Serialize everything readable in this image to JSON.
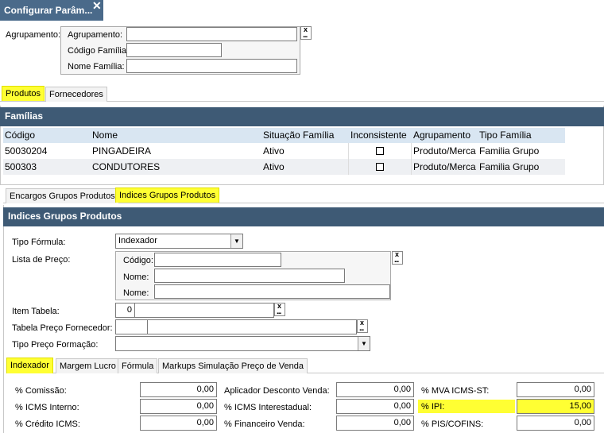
{
  "window": {
    "title": "Configurar Parâm..."
  },
  "agrupamento": {
    "outer_label": "Agrupamento:",
    "fields": [
      {
        "label": "Agrupamento:",
        "value": ""
      },
      {
        "label": "Código Família:",
        "value": ""
      },
      {
        "label": "Nome Família:",
        "value": ""
      }
    ]
  },
  "top_tabs": [
    "Produtos",
    "Fornecedores"
  ],
  "familias": {
    "title": "Famílias",
    "columns": [
      "Código",
      "Nome",
      "Situação Família",
      "Inconsistente",
      "Agrupamento",
      "Tipo Família"
    ],
    "rows": [
      {
        "codigo": "50030204",
        "nome": "PINGADEIRA",
        "situacao": "Ativo",
        "inconsistente": false,
        "agrupamento": "Produto/Merca",
        "tipo": "Familia Grupo"
      },
      {
        "codigo": "500303",
        "nome": "CONDUTORES",
        "situacao": "Ativo",
        "inconsistente": false,
        "agrupamento": "Produto/Merca",
        "tipo": "Familia Grupo"
      }
    ]
  },
  "sub_tabs": [
    "Encargos Grupos Produtos",
    "Indices Grupos Produtos"
  ],
  "indices": {
    "title": "Indices Grupos Produtos",
    "tipo_formula": {
      "label": "Tipo Fórmula:",
      "value": "Indexador"
    },
    "lista_preco": {
      "label": "Lista de Preço:",
      "codigo_label": "Código:",
      "codigo_value": "",
      "nome1_label": "Nome:",
      "nome1_value": "",
      "nome2_label": "Nome:",
      "nome2_value": ""
    },
    "item_tabela": {
      "label": "Item Tabela:",
      "value": "0",
      "value2": ""
    },
    "tabela_fornecedor": {
      "label": "Tabela Preço Fornecedor:",
      "value": "",
      "value2": ""
    },
    "tipo_preco": {
      "label": "Tipo Preço Formação:",
      "value": ""
    }
  },
  "bottom_tabs": [
    "Indexador",
    "Margem Lucro",
    "Fórmula",
    "Markups Simulação Preço de Venda"
  ],
  "indexador": {
    "rows": [
      [
        {
          "label": "% Comissão:",
          "value": "0,00"
        },
        {
          "label": "Aplicador Desconto Venda:",
          "value": "0,00"
        },
        {
          "label": "% MVA ICMS-ST:",
          "value": "0,00"
        }
      ],
      [
        {
          "label": "% ICMS Interno:",
          "value": "0,00"
        },
        {
          "label": "% ICMS Interestadual:",
          "value": "0,00"
        },
        {
          "label": "% IPI:",
          "value": "15,00"
        }
      ],
      [
        {
          "label": "% Crédito ICMS:",
          "value": "0,00"
        },
        {
          "label": "% Financeiro Venda:",
          "value": "0,00"
        },
        {
          "label": "% PIS/COFINS:",
          "value": "0,00"
        }
      ]
    ]
  },
  "colors": {
    "header_blue": "#3e5a75",
    "highlight": "#ffff33",
    "window_title_bg": "#4a6a8a"
  }
}
